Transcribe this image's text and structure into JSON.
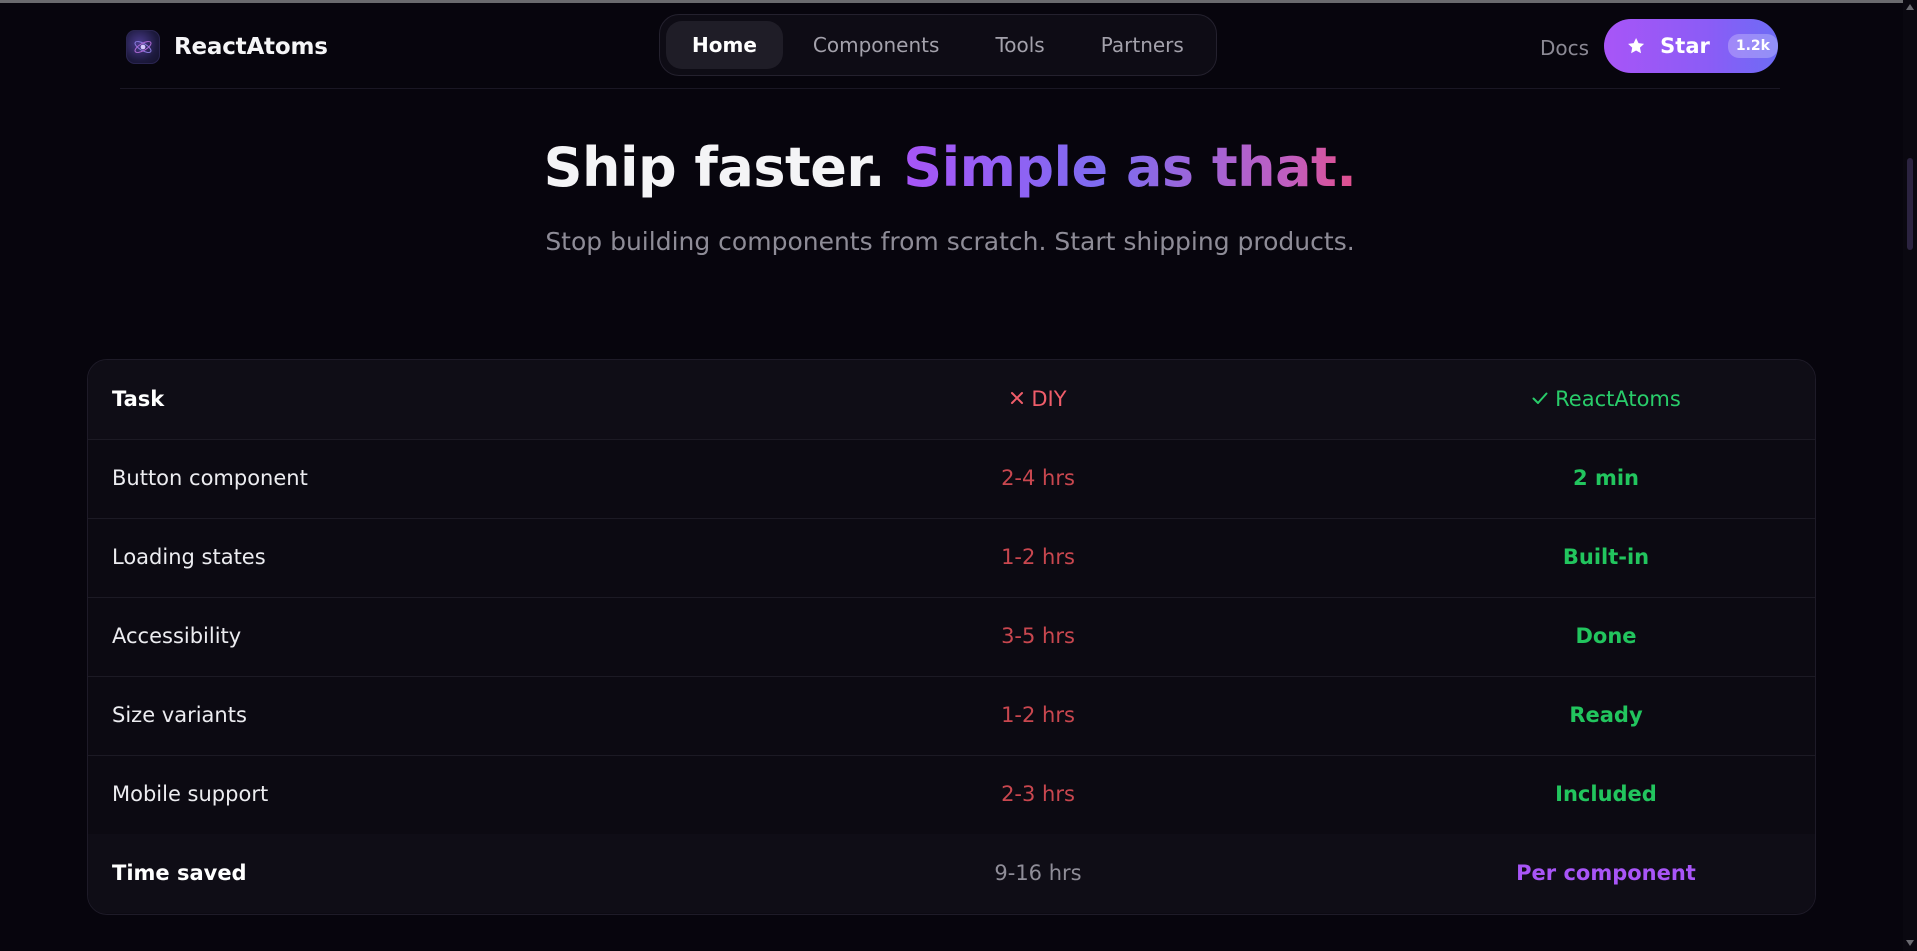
{
  "brand": {
    "name": "ReactAtoms"
  },
  "nav": {
    "items": [
      {
        "label": "Home",
        "active": true
      },
      {
        "label": "Components",
        "active": false
      },
      {
        "label": "Tools",
        "active": false
      },
      {
        "label": "Partners",
        "active": false
      }
    ]
  },
  "header": {
    "docs_label": "Docs",
    "star_label": "Star",
    "star_count": "1.2k"
  },
  "hero": {
    "title_plain": "Ship faster.",
    "title_highlight": "Simple as that.",
    "subtitle": "Stop building components from scratch. Start shipping products."
  },
  "comparison": {
    "headers": {
      "task": "Task",
      "diy": "DIY",
      "reactatoms": "ReactAtoms"
    },
    "rows": [
      {
        "task": "Button component",
        "diy": "2-4 hrs",
        "reactatoms": "2 min"
      },
      {
        "task": "Loading states",
        "diy": "1-2 hrs",
        "reactatoms": "Built-in"
      },
      {
        "task": "Accessibility",
        "diy": "3-5 hrs",
        "reactatoms": "Done"
      },
      {
        "task": "Size variants",
        "diy": "1-2 hrs",
        "reactatoms": "Ready"
      },
      {
        "task": "Mobile support",
        "diy": "2-3 hrs",
        "reactatoms": "Included"
      }
    ],
    "footer": {
      "task": "Time saved",
      "diy": "9-16 hrs",
      "reactatoms": "Per component"
    }
  },
  "colors": {
    "accent": "#a855f7",
    "diy_red": "#c9474f",
    "success_green": "#22c55e",
    "background": "#07050d"
  },
  "icons": {
    "logo": "atom-logo-icon",
    "star": "star-icon",
    "diy_header": "x-icon",
    "reactatoms_header": "check-icon"
  }
}
